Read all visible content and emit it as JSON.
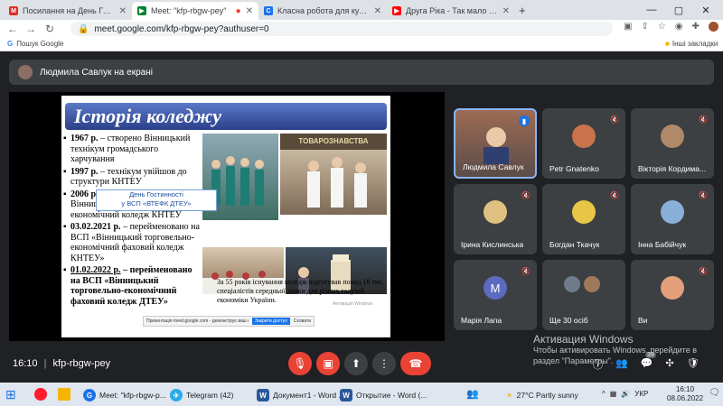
{
  "tabs": [
    {
      "title": "Посилання на День Гостинност",
      "fav": "M",
      "color": "#d93025"
    },
    {
      "title": "Meet: \"kfp-rbgw-pey\"",
      "fav": "▶",
      "color": "#00832d"
    },
    {
      "title": "Класна робота для курсу \"ФБС",
      "fav": "C",
      "color": "#1a73e8"
    },
    {
      "title": "Друга Ріка - Так мало тут тебе",
      "fav": "▶",
      "color": "#ff0000"
    }
  ],
  "new_tab_glyph": "+",
  "omnibox": {
    "url": "meet.google.com/kfp-rbgw-pey?authuser=0"
  },
  "bookmarks": {
    "left": "Пошук Google",
    "right": "Інші закладки"
  },
  "presenter": {
    "label": "Людмила Савлук на екрані"
  },
  "slide": {
    "title": "Історія коледжу",
    "bullets": [
      {
        "year": "1967 р.",
        "text": " – створено Вінницький технікум громадського харчування"
      },
      {
        "year": "1997 р.",
        "text": " – технікум увійшов до структури КНТЕУ"
      },
      {
        "year": "2006 р.",
        "text": " – отримав назву Вінницький торговельно-економічний коледж КНТЕУ"
      },
      {
        "year": "03.02.2021 р.",
        "text": " – перейменовано на ВСП «Вінницький торговельно-економічний фаховий коледж КНТЕУ»"
      },
      {
        "year": "01.02.2022 р.",
        "text": " – перейменовано на ВСП «Вінницький торговельно-економічний фаховий коледж ДТЕУ»"
      }
    ],
    "photo_banner": "ТОВАРОЗНАВСТВА",
    "hospitality_line1": "День Гостинності",
    "hospitality_line2": "у ВСП «ВТЕФК ДТЕУ»",
    "stat_text": "За 55 років існування коледж підготував понад 18 тис. спеціалістів середньої ланки для різних галузей економіки України.",
    "share_text": "Презентація meet.google.com - демонструє ваш екран і аудіо ресурс",
    "share_stop": "Закрити доступ",
    "share_hide": "Сховати",
    "watermark": "Активація Windows"
  },
  "participants": [
    {
      "name": "Людмила Савлук",
      "color": "#d9a97a",
      "active": true
    },
    {
      "name": "Petr Gnatenko",
      "color": "#c8734b",
      "active": false
    },
    {
      "name": "Вікторія Кордима...",
      "color": "#b08968",
      "active": false
    },
    {
      "name": "Ірина Кислинська",
      "color": "#e0c080",
      "active": false
    },
    {
      "name": "Богдан Ткачук",
      "color": "#e8c547",
      "active": false
    },
    {
      "name": "Інна Бабійчук",
      "color": "#8bb0d8",
      "active": false
    },
    {
      "name": "Марія Лапа",
      "initial": "М",
      "color": "#5c6bc0",
      "active": false
    },
    {
      "name": "Ще 30 осіб",
      "color": "#7a7a7a",
      "active": false
    },
    {
      "name": "Ви",
      "color": "#e5a07b",
      "active": false
    }
  ],
  "meeting": {
    "time": "16:10",
    "sep": "|",
    "code": "kfp-rbgw-pey",
    "badge": "39"
  },
  "activation": {
    "title": "Активация Windows",
    "line2": "Чтобы активировать Windows, перейдите в",
    "line3": "раздел \"Параметры\"."
  },
  "taskbar": {
    "search_hint": "",
    "items": [
      {
        "label": "Meet: \"kfp-rbgw-p...",
        "color": "#1a73e8",
        "glyph": "G"
      },
      {
        "label": "Telegram (42)",
        "color": "#2aabee",
        "glyph": "✈"
      },
      {
        "label": "Документ1 - Word ...",
        "color": "#2b579a",
        "glyph": "W"
      },
      {
        "label": "Открытие - Word (...",
        "color": "#2b579a",
        "glyph": "W"
      }
    ],
    "weather": "27°C  Partly sunny",
    "lang": "УКР",
    "clock_time": "16:10",
    "clock_date": "08.06.2022"
  },
  "colors": {
    "end_call": "#ea4335",
    "accent": "#8ab4f8"
  }
}
